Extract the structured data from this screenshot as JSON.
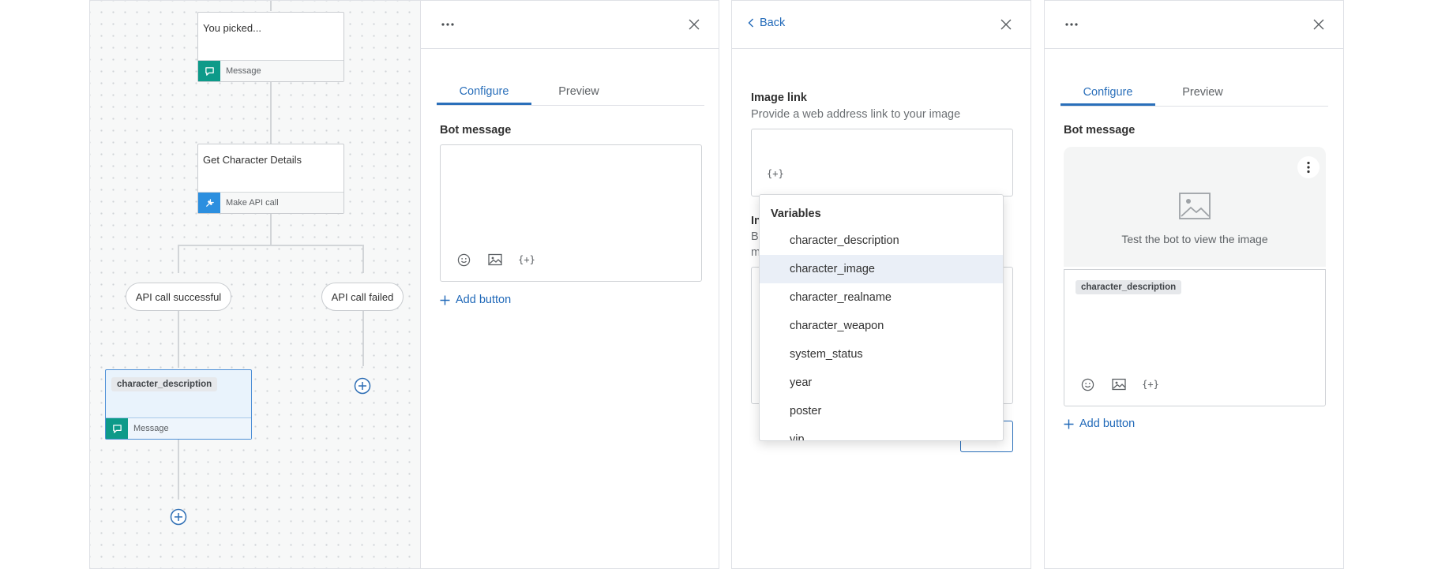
{
  "canvas": {
    "nodes": {
      "picked": {
        "title": "You picked...",
        "foot_label": "Message",
        "icon": "message-icon"
      },
      "api": {
        "title": "Get Character Details",
        "foot_label": "Make API call",
        "icon": "api-plug-icon"
      },
      "desc": {
        "chip": "character_description",
        "foot_label": "Message",
        "icon": "message-icon"
      }
    },
    "branches": {
      "success": "API call successful",
      "failed": "API call failed"
    },
    "colors": {
      "message_icon_bg": "#0d9a89",
      "api_icon_bg": "#2c8fdf",
      "selected_border": "#4d8fd6"
    }
  },
  "panel1": {
    "tabs": [
      {
        "label": "Configure",
        "active": true
      },
      {
        "label": "Preview",
        "active": false
      }
    ],
    "bot_message_label": "Bot message",
    "add_button_label": "Add button",
    "var_glyph": "{+}"
  },
  "panel2": {
    "back_label": "Back",
    "image_link_label": "Image link",
    "image_link_help": "Provide a web address link to your image",
    "var_glyph": "{+}",
    "dropdown": {
      "title": "Variables",
      "items": [
        "character_description",
        "character_image",
        "character_realname",
        "character_weapon",
        "system_status",
        "year",
        "poster",
        "vip"
      ],
      "highlighted_index": 1
    },
    "hidden_frags": {
      "label_initial": "In",
      "help_initial_1": "B",
      "help_initial_2": "m"
    }
  },
  "panel3": {
    "tabs": [
      {
        "label": "Configure",
        "active": true
      },
      {
        "label": "Preview",
        "active": false
      }
    ],
    "bot_message_label": "Bot message",
    "image_placeholder_text": "Test the bot to view the image",
    "chip": "character_description",
    "add_button_label": "Add button",
    "var_glyph": "{+}"
  }
}
